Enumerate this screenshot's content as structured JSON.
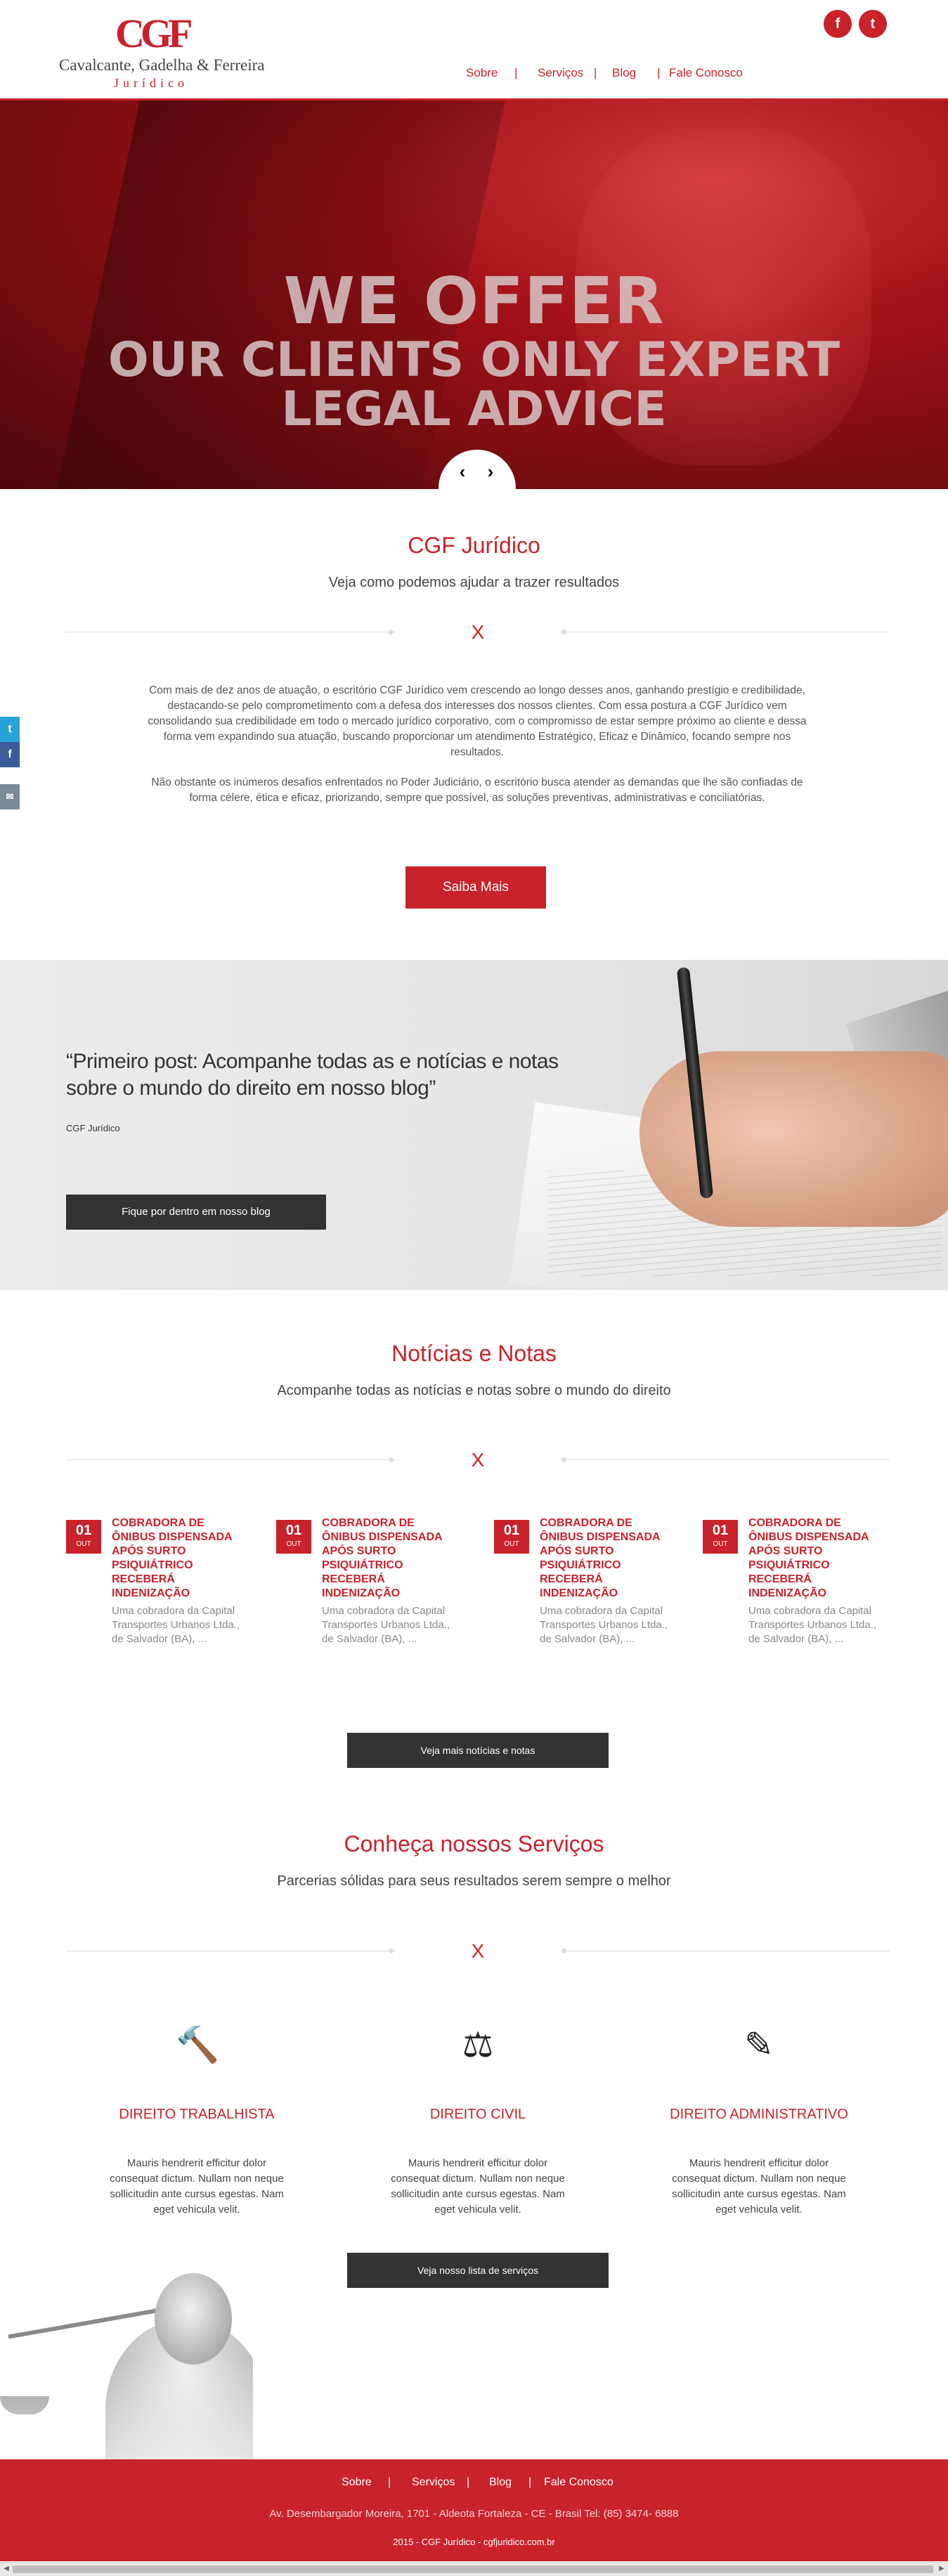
{
  "header": {
    "logo_mark": "CGF",
    "logo_name": "Cavalcante, Gadelha & Ferreira",
    "logo_sub": "Jurídico",
    "nav": [
      "Sobre",
      "Serviços",
      "Blog",
      "Fale Conosco"
    ],
    "separator": "|",
    "social": {
      "facebook": "f",
      "twitter": "t"
    }
  },
  "hero": {
    "line1": "WE OFFER",
    "line2": "OUR CLIENTS ONLY EXPERT",
    "line3": "LEGAL ADVICE",
    "prev": "‹",
    "next": "›"
  },
  "side_share": {
    "twitter": "t",
    "facebook": "f",
    "email": "✉"
  },
  "about": {
    "title": "CGF Jurídico",
    "subtitle": "Veja como podemos ajudar a trazer resultados",
    "divider_mark": "X",
    "paragraph1": "Com mais de dez anos de atuação, o escritório CGF Jurídico vem crescendo ao longo desses anos, ganhando prestígio e credibilidade, destacando-se pelo comprometimento com a defesa dos interesses dos nossos clientes. Com essa postura a CGF Jurídico vem consolidando sua credibilidade em todo o mercado jurídico corporativo, com o compromisso de estar sempre próximo ao cliente e dessa forma vem expandindo sua atuação, buscando proporcionar um atendimento Estratégico, Eficaz e Dinâmico, focando sempre nos resultados.",
    "paragraph2": "Não obstante os inúmeros desafios enfrentados no Poder Judiciário, o escritório busca atender as demandas que lhe são confiadas de forma célere, ética e eficaz, priorizando, sempre que possível, as soluções preventivas, administrativas e conciliatórias.",
    "button": "Saiba Mais"
  },
  "blog": {
    "quote": "“Primeiro post: Acompanhe todas as  e notícias e notas sobre o mundo do direito em nosso blog”",
    "author": "CGF Jurídico",
    "button": "Fique por dentro  em nosso blog"
  },
  "news": {
    "title": "Notícias e Notas",
    "subtitle": "Acompanhe todas as notícias e notas sobre o mundo do direito",
    "divider_mark": "X",
    "items": [
      {
        "day": "01",
        "month": "OUT",
        "title": "COBRADORA DE ÔNIBUS DISPENSADA APÓS SURTO PSIQUIÁTRICO RECEBERÁ INDENIZAÇÃO",
        "excerpt": "Uma cobradora da Capital Transportes Urbanos Ltda., de Salvador (BA), ..."
      },
      {
        "day": "01",
        "month": "OUT",
        "title": "COBRADORA DE ÔNIBUS DISPENSADA APÓS SURTO PSIQUIÁTRICO RECEBERÁ INDENIZAÇÃO",
        "excerpt": "Uma cobradora da Capital Transportes Urbanos Ltda., de Salvador (BA), ..."
      },
      {
        "day": "01",
        "month": "OUT",
        "title": "COBRADORA DE ÔNIBUS DISPENSADA APÓS SURTO PSIQUIÁTRICO RECEBERÁ INDENIZAÇÃO",
        "excerpt": "Uma cobradora da Capital Transportes Urbanos Ltda., de Salvador (BA), ..."
      },
      {
        "day": "01",
        "month": "OUT",
        "title": "COBRADORA DE ÔNIBUS DISPENSADA APÓS SURTO PSIQUIÁTRICO RECEBERÁ INDENIZAÇÃO",
        "excerpt": "Uma cobradora da Capital Transportes Urbanos Ltda., de Salvador (BA), ..."
      }
    ],
    "button": "Veja  mais notícias e notas"
  },
  "services": {
    "title": "Conheça nossos Serviços",
    "subtitle": "Parcerias sólidas para seus resultados serem sempre o melhor",
    "divider_mark": "X",
    "items": [
      {
        "icon": "gavel-icon",
        "glyph": "🔨",
        "title": "DIREITO TRABALHISTA",
        "desc": "Mauris hendrerit efficitur dolor consequat dictum. Nullam non neque sollicitudin ante cursus egestas. Nam eget vehicula velit."
      },
      {
        "icon": "scales-icon",
        "glyph": "⚖",
        "title": "DIREITO CIVIL",
        "desc": "Mauris hendrerit efficitur dolor consequat dictum. Nullam non neque sollicitudin ante cursus egestas. Nam eget vehicula velit."
      },
      {
        "icon": "document-icon",
        "glyph": "✎",
        "title": "DIREITO ADMINISTRATIVO",
        "desc": "Mauris hendrerit efficitur dolor consequat dictum. Nullam non neque sollicitudin ante cursus egestas. Nam eget vehicula velit."
      }
    ],
    "button": "Veja nosso lista de serviços"
  },
  "footer": {
    "nav": [
      "Sobre",
      "Serviços",
      "Blog",
      "Fale Conosco"
    ],
    "separator": "|",
    "address": "Av. Desembargador Moreira, 1701 - Aldeota Fortaleza - CE - Brasil Tel: (85) 3474- 6888",
    "copyright": "2015 - CGF Jurídico - cgfjuridico.com.br"
  },
  "colors": {
    "accent": "#c8222b",
    "dark_button": "#333333"
  }
}
